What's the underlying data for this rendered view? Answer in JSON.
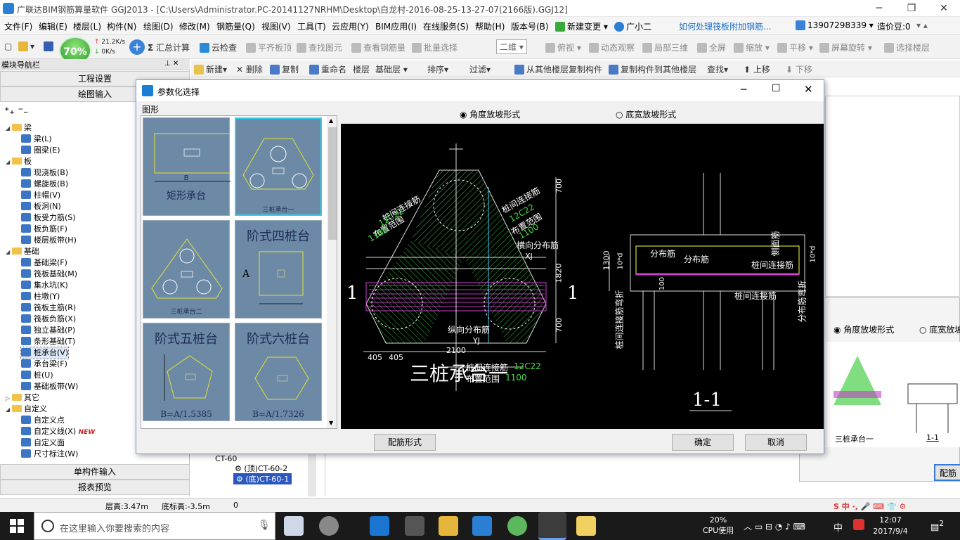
{
  "window": {
    "title": "广联达BIM钢筋算量软件 GGJ2013 - [C:\\Users\\Administrator.PC-20141127NRHM\\Desktop\\白龙村-2016-08-25-13-27-07(2166版).GGJ12]",
    "min": "─",
    "max": "❐",
    "close": "✕"
  },
  "menu": [
    "文件(F)",
    "编辑(E)",
    "楼层(L)",
    "构件(N)",
    "绘图(D)",
    "修改(M)",
    "钢筋量(Q)",
    "视图(V)",
    "工具(T)",
    "云应用(Y)",
    "BIM应用(I)",
    "在线服务(S)",
    "帮助(H)",
    "版本号(B)",
    "新建变更",
    "广小二"
  ],
  "menu_right": {
    "question": "如何处理筏板附加钢筋...",
    "phone": "13907298339",
    "price": "造价豆:0"
  },
  "net": {
    "percent": "70%",
    "up": "21.2K/s",
    "down": "0K/s"
  },
  "toolbar1": [
    "汇总计算",
    "云检查",
    "平齐板顶",
    "查找图元",
    "查看钢筋量",
    "批量选择",
    "二维",
    "俯视",
    "动态观察",
    "局部三维",
    "全屏",
    "缩放",
    "平移",
    "屏幕旋转",
    "选择楼层"
  ],
  "toolbar2": [
    "新建",
    "删除",
    "复制",
    "重命名",
    "楼层",
    "基础层",
    "排序",
    "过滤",
    "从其他楼层复制构件",
    "复制构件到其他楼层",
    "查找",
    "上移",
    "下移"
  ],
  "leftpanel": {
    "header": "模块导航栏",
    "tab_settings": "工程设置",
    "tab_draw": "绘图输入",
    "tree": [
      {
        "level": 0,
        "label": "梁",
        "folder": true
      },
      {
        "level": 1,
        "label": "梁(L)"
      },
      {
        "level": 1,
        "label": "圈梁(E)"
      },
      {
        "level": 0,
        "label": "板",
        "folder": true
      },
      {
        "level": 1,
        "label": "现浇板(B)"
      },
      {
        "level": 1,
        "label": "螺旋板(B)"
      },
      {
        "level": 1,
        "label": "柱帽(V)"
      },
      {
        "level": 1,
        "label": "板洞(N)"
      },
      {
        "level": 1,
        "label": "板受力筋(S)"
      },
      {
        "level": 1,
        "label": "板负筋(F)"
      },
      {
        "level": 1,
        "label": "楼层板带(H)"
      },
      {
        "level": 0,
        "label": "基础",
        "folder": true
      },
      {
        "level": 1,
        "label": "基础梁(F)"
      },
      {
        "level": 1,
        "label": "筏板基础(M)"
      },
      {
        "level": 1,
        "label": "集水坑(K)"
      },
      {
        "level": 1,
        "label": "柱墩(Y)"
      },
      {
        "level": 1,
        "label": "筏板主筋(R)"
      },
      {
        "level": 1,
        "label": "筏板负筋(X)"
      },
      {
        "level": 1,
        "label": "独立基础(P)"
      },
      {
        "level": 1,
        "label": "条形基础(T)"
      },
      {
        "level": 1,
        "label": "桩承台(V)",
        "selected": true
      },
      {
        "level": 1,
        "label": "承台梁(F)"
      },
      {
        "level": 1,
        "label": "桩(U)"
      },
      {
        "level": 1,
        "label": "基础板带(W)"
      },
      {
        "level": 0,
        "label": "其它",
        "folder": true,
        "collapsed": true
      },
      {
        "level": 0,
        "label": "自定义",
        "folder": true
      },
      {
        "level": 1,
        "label": "自定义点"
      },
      {
        "level": 1,
        "label": "自定义线(X)",
        "badge": "NEW"
      },
      {
        "level": 1,
        "label": "自定义面"
      },
      {
        "level": 1,
        "label": "尺寸标注(W)"
      }
    ],
    "tab_single": "单构件输入",
    "tab_report": "报表预览"
  },
  "component_list": [
    "CT-60",
    "(顶)CT-60-2",
    "(底)CT-60-1"
  ],
  "status": {
    "floor_height": "层高:3.47m",
    "bottom": "底标高:-3.5m",
    "count": "0"
  },
  "dialog": {
    "title": "参数化选择",
    "group_label": "图形",
    "radio_angle": "角度放坡形式",
    "radio_width": "底宽放坡形式",
    "thumbs": [
      {
        "name": "矩形承台",
        "note": "B"
      },
      {
        "name": "三桩承台一"
      },
      {
        "name": "三桩承台二"
      },
      {
        "name": "阶式四桩台",
        "note": "A"
      },
      {
        "name": "阶式五桩台",
        "note": "B=A/1.5385"
      },
      {
        "name": "阶式六桩台",
        "note": "B=A/1.7326"
      }
    ],
    "btn_rebar": "配筋形式",
    "btn_ok": "确定",
    "btn_cancel": "取消"
  },
  "cad": {
    "title": "三桩承台一",
    "section": "1-1",
    "mark": "1",
    "labels": {
      "pile_link": "桩间连接筋",
      "spec": "12C22",
      "range": "布置范围",
      "len": "1100",
      "trans": "横向分布筋",
      "long": "纵向分布筋",
      "dist": "分布筋",
      "side": "侧面筋",
      "pile_bend": "桩间连接筋弯折",
      "dist_bend": "分布筋弯折",
      "xj": "XJ",
      "yj": "YJ",
      "d700": "700",
      "d1820": "1820",
      "d2100": "2100",
      "d405": "405",
      "d1300": "1300",
      "d10d": "10*d",
      "d100": "100"
    }
  },
  "preview2": {
    "radio_angle": "角度放坡形式",
    "radio_width": "底宽放坡",
    "title": "三桩承台一",
    "section": "1-1",
    "btn": "配筋"
  },
  "taskbar": {
    "search": "在这里输入你要搜索的内容",
    "cpu": "20%",
    "cpu_label": "CPU使用",
    "ime": "中",
    "time": "12:07",
    "date": "2017/9/4",
    "notif": "2"
  }
}
